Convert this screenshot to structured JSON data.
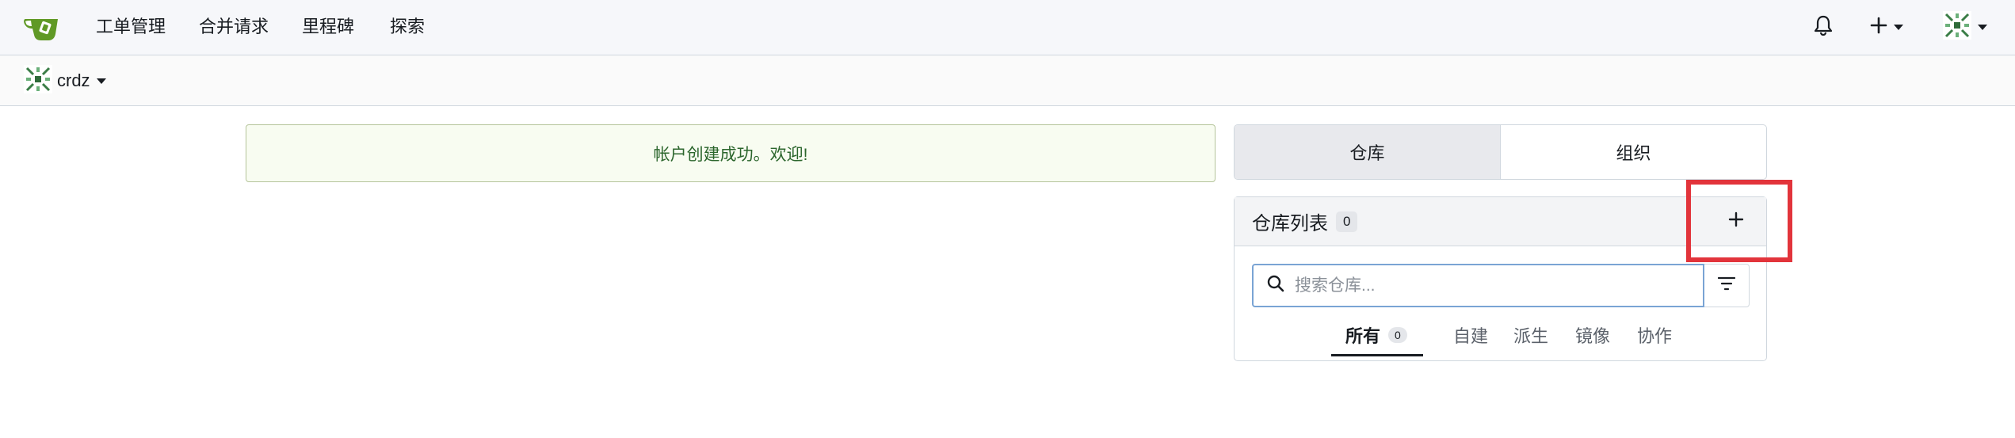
{
  "navbar": {
    "items": [
      {
        "label": "工单管理"
      },
      {
        "label": "合并请求"
      },
      {
        "label": "里程碑"
      },
      {
        "label": "探索"
      }
    ]
  },
  "context": {
    "username": "crdz"
  },
  "flash": {
    "message": "帐户创建成功。欢迎!"
  },
  "tabs": [
    {
      "label": "仓库",
      "active": true
    },
    {
      "label": "组织",
      "active": false
    }
  ],
  "repo_panel": {
    "title": "仓库列表",
    "count": "0",
    "search_placeholder": "搜索仓库...",
    "filters": [
      {
        "label": "所有",
        "count": "0",
        "active": true
      },
      {
        "label": "自建"
      },
      {
        "label": "派生"
      },
      {
        "label": "镜像"
      },
      {
        "label": "协作"
      }
    ]
  },
  "colors": {
    "accent_green": "#609926",
    "highlight_red": "#e2343b",
    "flash_text": "#2c662d"
  },
  "icons": [
    "gitea-logo-icon",
    "bell-icon",
    "plus-icon",
    "avatar-icon",
    "search-icon",
    "filter-icon"
  ]
}
